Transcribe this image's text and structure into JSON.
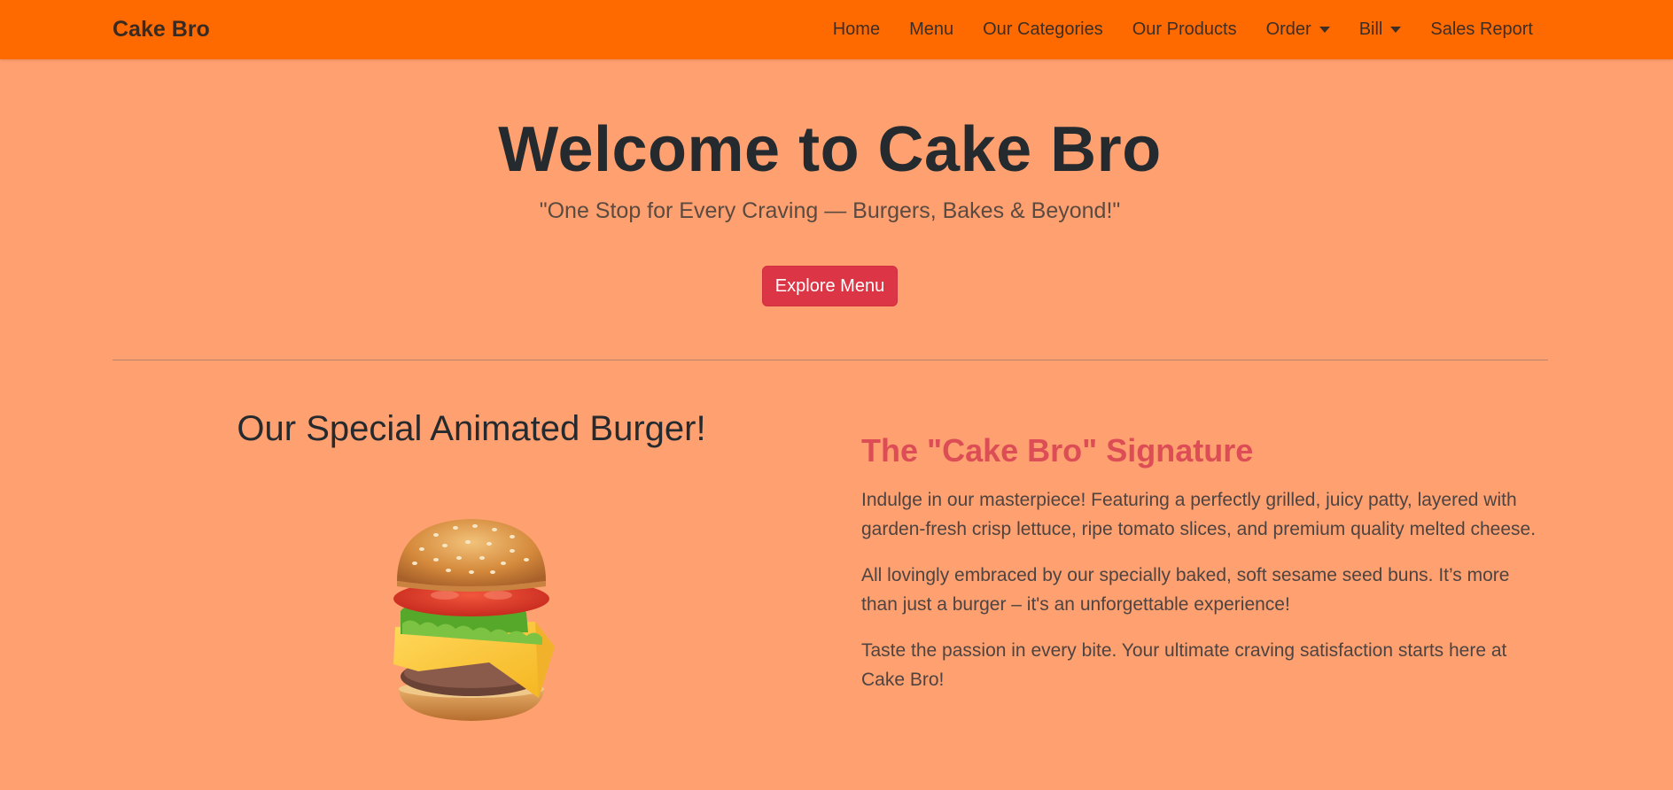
{
  "navbar": {
    "brand": "Cake Bro",
    "items": [
      {
        "label": "Home",
        "dropdown": false
      },
      {
        "label": "Menu",
        "dropdown": false
      },
      {
        "label": "Our Categories",
        "dropdown": false
      },
      {
        "label": "Our Products",
        "dropdown": false
      },
      {
        "label": "Order",
        "dropdown": true
      },
      {
        "label": "Bill",
        "dropdown": true
      },
      {
        "label": "Sales Report",
        "dropdown": false
      }
    ]
  },
  "hero": {
    "title": "Welcome to Cake Bro",
    "subtitle": "\"One Stop for Every Craving — Burgers, Bakes & Beyond!\"",
    "button_label": "Explore Menu"
  },
  "feature": {
    "left_title": "Our Special Animated Burger!",
    "image_icon": "burger-image",
    "signature_title": "The \"Cake Bro\" Signature",
    "paragraphs": [
      "Indulge in our masterpiece! Featuring a perfectly grilled, juicy patty, layered with garden-fresh crisp lettuce, ripe tomato slices, and premium quality melted cheese.",
      "All lovingly embraced by our specially baked, soft sesame seed buns. It’s more than just a burger – it's an unforgettable experience!",
      "Taste the passion in every bite. Your ultimate craving satisfaction starts here at Cake Bro!"
    ]
  },
  "colors": {
    "navbar": "#ff6a00",
    "page_background": "#ffa070",
    "button": "#dc3545",
    "signature_title": "#dc4d56"
  }
}
